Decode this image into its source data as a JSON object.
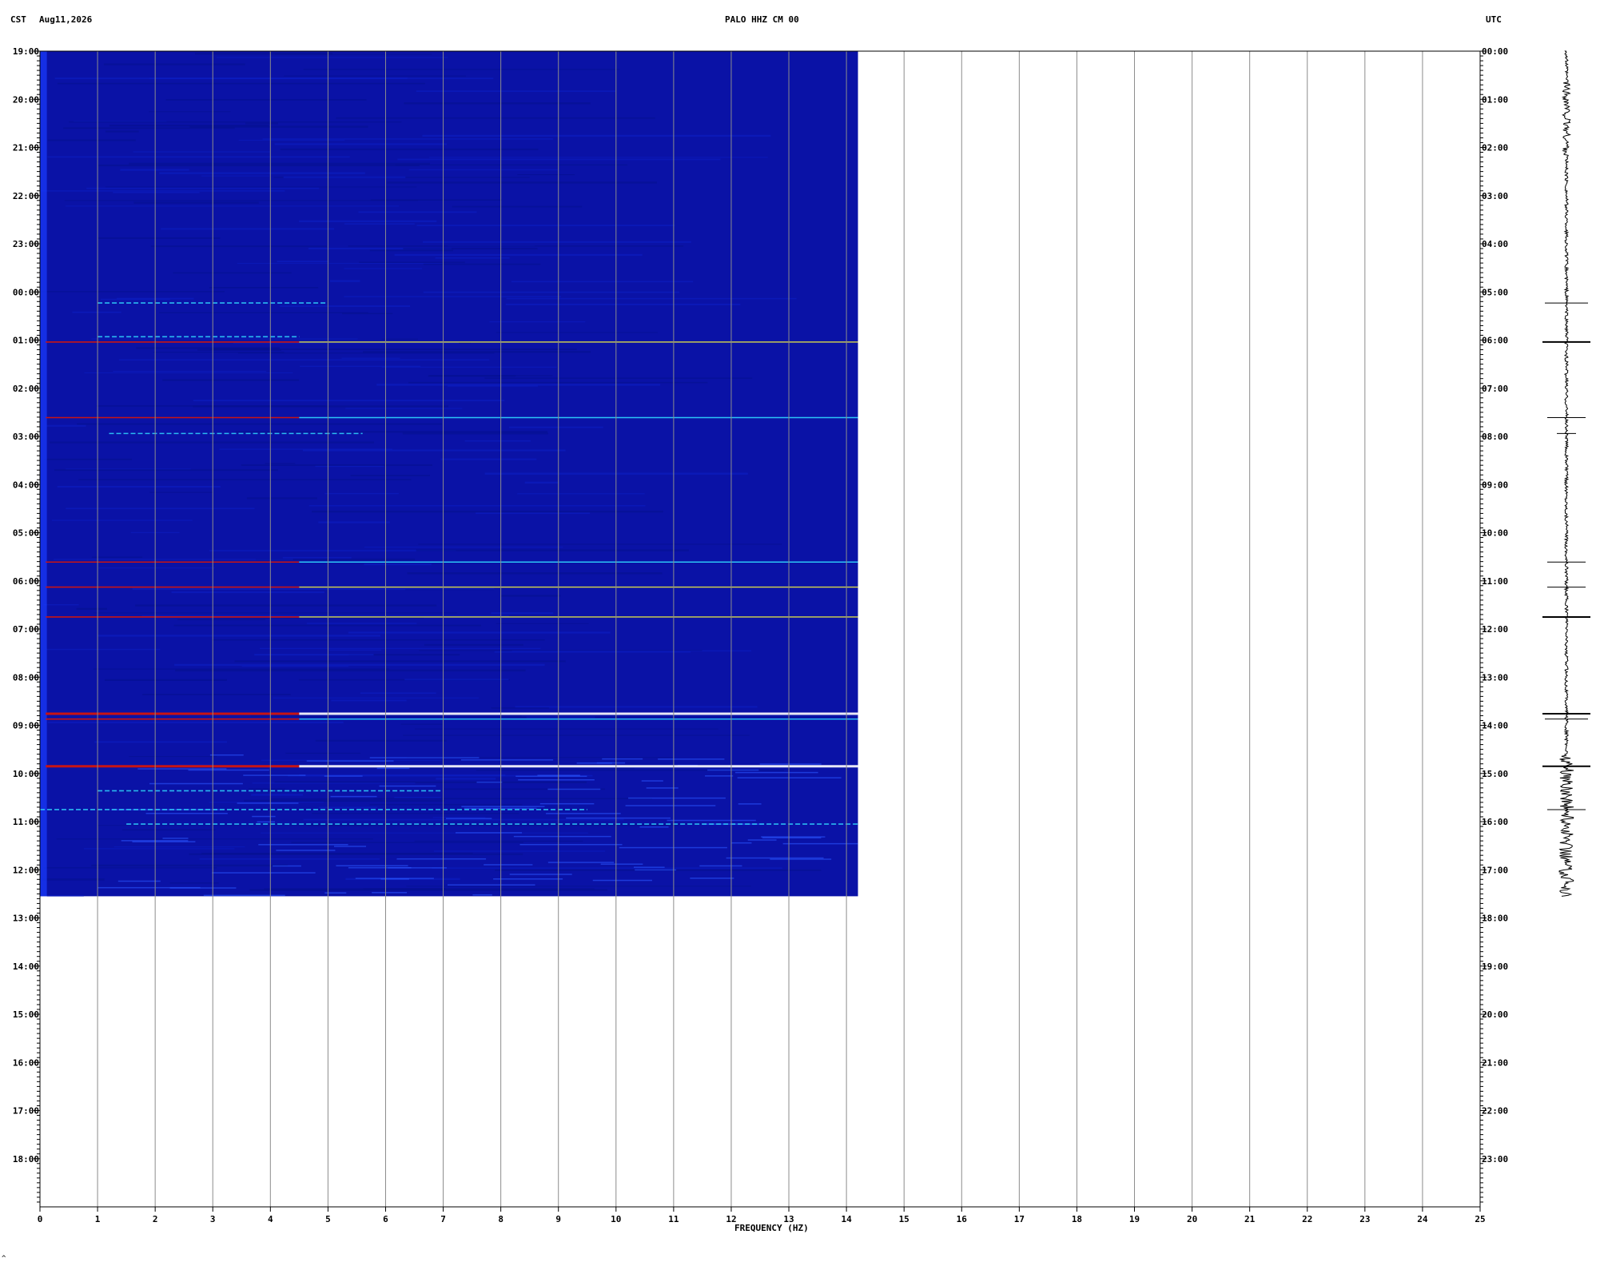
{
  "header": {
    "left_timezone": "CST",
    "date": "Aug11,2026",
    "station": "PALO HHZ CM 00",
    "right_timezone": "UTC"
  },
  "colors": {
    "background": "#0a12a6",
    "grid": "#8c8c8c",
    "axis": "#000000",
    "spectral_line_red": "#c81414",
    "spectral_line_cyan": "#30d8ff",
    "spectral_line_yellow": "#f0f040",
    "spectral_line_white": "#ffffff"
  },
  "chart_data": {
    "type": "heatmap",
    "title": "PALO HHZ CM 00",
    "xlabel": "FREQUENCY (HZ)",
    "ylabel": "",
    "xlim": [
      0,
      25
    ],
    "x_ticks": [
      "0",
      "1",
      "2",
      "3",
      "4",
      "5",
      "6",
      "7",
      "8",
      "9",
      "10",
      "11",
      "12",
      "13",
      "14",
      "15",
      "16",
      "17",
      "18",
      "19",
      "20",
      "21",
      "22",
      "23",
      "24",
      "25"
    ],
    "ylim_hours": [
      0,
      24
    ],
    "y_ticks_left_cst": [
      "19:00",
      "20:00",
      "21:00",
      "22:00",
      "23:00",
      "00:00",
      "01:00",
      "02:00",
      "03:00",
      "04:00",
      "05:00",
      "06:00",
      "07:00",
      "08:00",
      "09:00",
      "10:00",
      "11:00",
      "12:00",
      "13:00",
      "14:00",
      "15:00",
      "16:00",
      "17:00",
      "18:00"
    ],
    "y_ticks_right_utc": [
      "00:00",
      "01:00",
      "02:00",
      "03:00",
      "04:00",
      "05:00",
      "06:00",
      "07:00",
      "08:00",
      "09:00",
      "10:00",
      "11:00",
      "12:00",
      "13:00",
      "14:00",
      "15:00",
      "16:00",
      "17:00",
      "18:00",
      "19:00",
      "20:00",
      "21:00",
      "22:00",
      "23:00"
    ],
    "data_coverage": {
      "freq_max_hz": 14.2,
      "hours_elapsed": 17.55
    },
    "grid": true,
    "spectral_events": [
      {
        "hour": 5.23,
        "freq_range": [
          1,
          5
        ],
        "intensity": "mid"
      },
      {
        "hour": 5.93,
        "freq_range": [
          1,
          4.5
        ],
        "intensity": "low"
      },
      {
        "hour": 6.04,
        "freq_range": [
          0,
          14.2
        ],
        "intensity": "high"
      },
      {
        "hour": 7.61,
        "freq_range": [
          0,
          14.2
        ],
        "intensity": "mid"
      },
      {
        "hour": 7.94,
        "freq_range": [
          1.2,
          5.6
        ],
        "intensity": "mid"
      },
      {
        "hour": 10.61,
        "freq_range": [
          0,
          14.2
        ],
        "intensity": "mid"
      },
      {
        "hour": 11.13,
        "freq_range": [
          0,
          14.2
        ],
        "intensity": "high"
      },
      {
        "hour": 11.75,
        "freq_range": [
          0,
          14.2
        ],
        "intensity": "high"
      },
      {
        "hour": 13.76,
        "freq_range": [
          0,
          14.2
        ],
        "intensity": "max"
      },
      {
        "hour": 13.87,
        "freq_range": [
          0,
          14.2
        ],
        "intensity": "mid"
      },
      {
        "hour": 14.85,
        "freq_range": [
          0,
          14.2
        ],
        "intensity": "max"
      },
      {
        "hour": 15.36,
        "freq_range": [
          1,
          7
        ],
        "intensity": "low"
      },
      {
        "hour": 15.75,
        "freq_range": [
          0,
          9.5
        ],
        "intensity": "mid"
      },
      {
        "hour": 16.05,
        "freq_range": [
          1.5,
          14.2
        ],
        "intensity": "mid"
      }
    ],
    "seismogram_events": [
      {
        "hour": 5.23,
        "amplitude": 0.9
      },
      {
        "hour": 6.04,
        "amplitude": 1.0
      },
      {
        "hour": 7.61,
        "amplitude": 0.8
      },
      {
        "hour": 7.94,
        "amplitude": 0.4
      },
      {
        "hour": 10.61,
        "amplitude": 0.8
      },
      {
        "hour": 11.13,
        "amplitude": 0.8
      },
      {
        "hour": 11.75,
        "amplitude": 1.0
      },
      {
        "hour": 13.76,
        "amplitude": 1.0
      },
      {
        "hour": 13.87,
        "amplitude": 0.9
      },
      {
        "hour": 14.85,
        "amplitude": 1.0
      },
      {
        "hour": 15.75,
        "amplitude": 0.8
      }
    ]
  },
  "footnote": "^"
}
